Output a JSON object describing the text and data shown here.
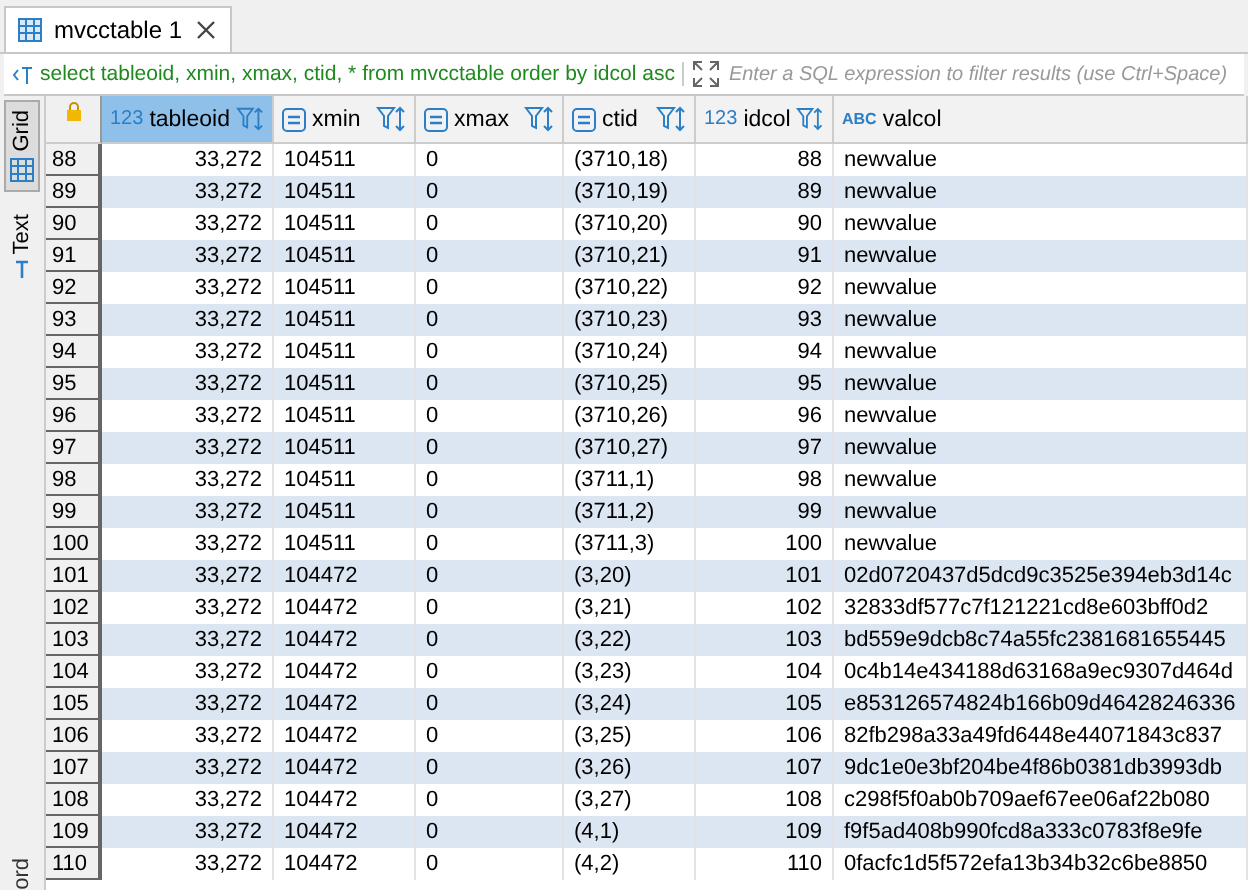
{
  "editor_tab": {
    "title": "mvcctable 1"
  },
  "query": {
    "sql": "select tableoid, xmin, xmax, ctid, * from mvcctable order by idcol asc",
    "placeholder": "Enter a SQL expression to filter results (use Ctrl+Space)"
  },
  "side_tabs": [
    {
      "label": "Grid",
      "selected": true
    },
    {
      "label": "Text",
      "selected": false
    }
  ],
  "side_footer": "ord",
  "columns": [
    {
      "label": "tableoid",
      "type_badge": "123",
      "kind": "number",
      "selected": true
    },
    {
      "label": "xmin",
      "kind": "special",
      "selected": false
    },
    {
      "label": "xmax",
      "kind": "special",
      "selected": false
    },
    {
      "label": "ctid",
      "kind": "special",
      "selected": false
    },
    {
      "label": "idcol",
      "type_badge": "123",
      "kind": "number",
      "selected": false
    },
    {
      "label": "valcol",
      "type_badge": "ABC",
      "kind": "string",
      "selected": false
    }
  ],
  "rows": [
    {
      "num": "88",
      "cells": [
        "33,272",
        "104511",
        "0",
        "(3710,18)",
        "88",
        "newvalue"
      ]
    },
    {
      "num": "89",
      "cells": [
        "33,272",
        "104511",
        "0",
        "(3710,19)",
        "89",
        "newvalue"
      ]
    },
    {
      "num": "90",
      "cells": [
        "33,272",
        "104511",
        "0",
        "(3710,20)",
        "90",
        "newvalue"
      ]
    },
    {
      "num": "91",
      "cells": [
        "33,272",
        "104511",
        "0",
        "(3710,21)",
        "91",
        "newvalue"
      ]
    },
    {
      "num": "92",
      "cells": [
        "33,272",
        "104511",
        "0",
        "(3710,22)",
        "92",
        "newvalue"
      ]
    },
    {
      "num": "93",
      "cells": [
        "33,272",
        "104511",
        "0",
        "(3710,23)",
        "93",
        "newvalue"
      ]
    },
    {
      "num": "94",
      "cells": [
        "33,272",
        "104511",
        "0",
        "(3710,24)",
        "94",
        "newvalue"
      ]
    },
    {
      "num": "95",
      "cells": [
        "33,272",
        "104511",
        "0",
        "(3710,25)",
        "95",
        "newvalue"
      ]
    },
    {
      "num": "96",
      "cells": [
        "33,272",
        "104511",
        "0",
        "(3710,26)",
        "96",
        "newvalue"
      ]
    },
    {
      "num": "97",
      "cells": [
        "33,272",
        "104511",
        "0",
        "(3710,27)",
        "97",
        "newvalue"
      ]
    },
    {
      "num": "98",
      "cells": [
        "33,272",
        "104511",
        "0",
        "(3711,1)",
        "98",
        "newvalue"
      ]
    },
    {
      "num": "99",
      "cells": [
        "33,272",
        "104511",
        "0",
        "(3711,2)",
        "99",
        "newvalue"
      ]
    },
    {
      "num": "100",
      "cells": [
        "33,272",
        "104511",
        "0",
        "(3711,3)",
        "100",
        "newvalue"
      ]
    },
    {
      "num": "101",
      "cells": [
        "33,272",
        "104472",
        "0",
        "(3,20)",
        "101",
        "02d0720437d5dcd9c3525e394eb3d14c"
      ]
    },
    {
      "num": "102",
      "cells": [
        "33,272",
        "104472",
        "0",
        "(3,21)",
        "102",
        "32833df577c7f121221cd8e603bff0d2"
      ]
    },
    {
      "num": "103",
      "cells": [
        "33,272",
        "104472",
        "0",
        "(3,22)",
        "103",
        "bd559e9dcb8c74a55fc2381681655445"
      ]
    },
    {
      "num": "104",
      "cells": [
        "33,272",
        "104472",
        "0",
        "(3,23)",
        "104",
        "0c4b14e434188d63168a9ec9307d464d"
      ]
    },
    {
      "num": "105",
      "cells": [
        "33,272",
        "104472",
        "0",
        "(3,24)",
        "105",
        "e853126574824b166b09d46428246336"
      ]
    },
    {
      "num": "106",
      "cells": [
        "33,272",
        "104472",
        "0",
        "(3,25)",
        "106",
        "82fb298a33a49fd6448e44071843c837"
      ]
    },
    {
      "num": "107",
      "cells": [
        "33,272",
        "104472",
        "0",
        "(3,26)",
        "107",
        "9dc1e0e3bf204be4f86b0381db3993db"
      ]
    },
    {
      "num": "108",
      "cells": [
        "33,272",
        "104472",
        "0",
        "(3,27)",
        "108",
        "c298f5f0ab0b709aef67ee06af22b080"
      ]
    },
    {
      "num": "109",
      "cells": [
        "33,272",
        "104472",
        "0",
        "(4,1)",
        "109",
        "f9f5ad408b990fcd8a333c0783f8e9fe"
      ]
    },
    {
      "num": "110",
      "cells": [
        "33,272",
        "104472",
        "0",
        "(4,2)",
        "110",
        "0facfc1d5f572efa13b34b32c6be8850"
      ]
    }
  ]
}
